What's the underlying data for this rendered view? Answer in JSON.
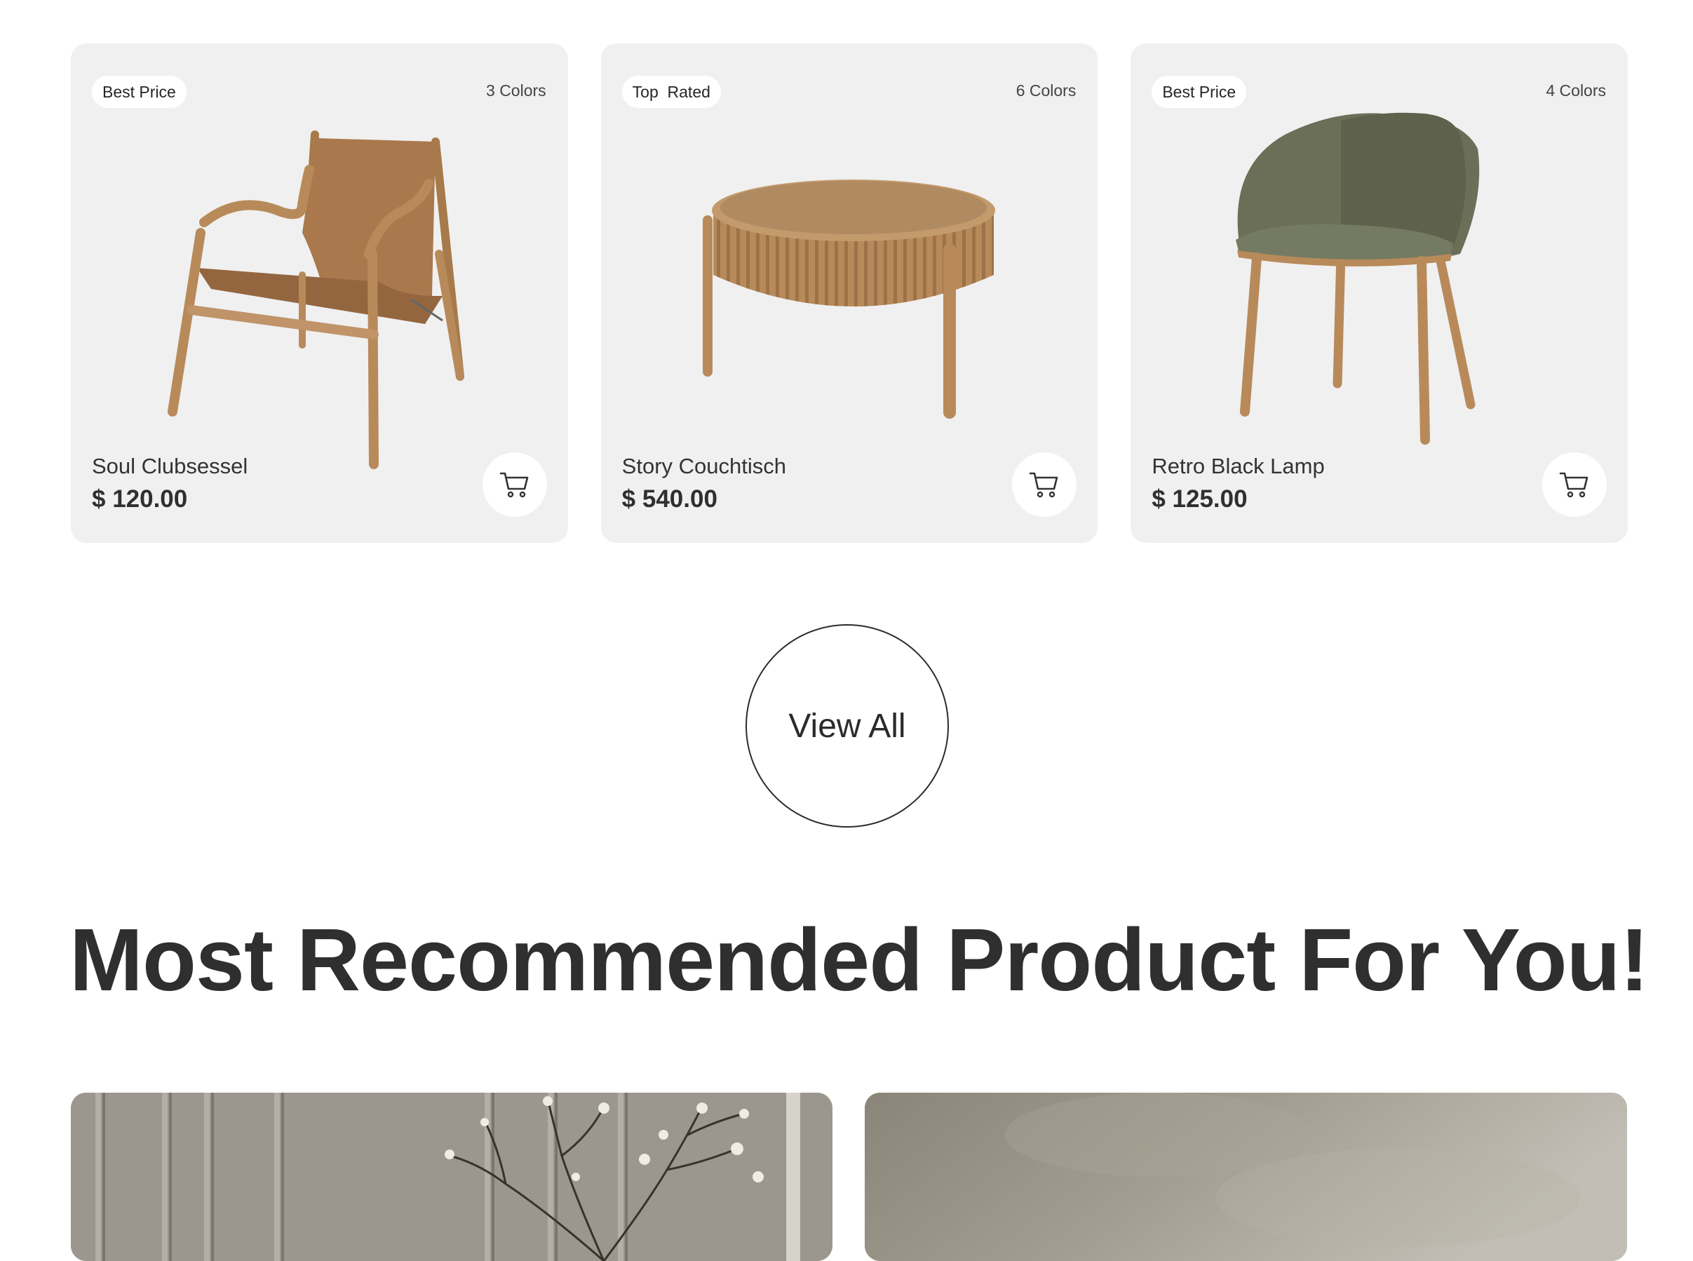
{
  "products": [
    {
      "badge": "Best Price",
      "colors": "3 Colors",
      "name": "Soul Clubsessel",
      "price": "$ 120.00",
      "image": "leather-armchair"
    },
    {
      "badge": "Top  Rated",
      "colors": "6 Colors",
      "name": "Story Couchtisch",
      "price": "$ 540.00",
      "image": "round-wooden-coffee-table"
    },
    {
      "badge": "Best Price",
      "colors": "4 Colors",
      "name": "Retro Black Lamp",
      "price": "$ 125.00",
      "image": "green-upholstered-chair"
    }
  ],
  "view_all_label": "View All",
  "recommended": {
    "heading": "Most Recommended Product For You!"
  },
  "icons": {
    "cart": "cart-icon"
  },
  "colors": {
    "card_bg": "#f0f0f0",
    "text": "#2f2f2f",
    "wood": "#b88a5a",
    "leather": "#a5744a",
    "fabric_green": "#6b6f58"
  }
}
